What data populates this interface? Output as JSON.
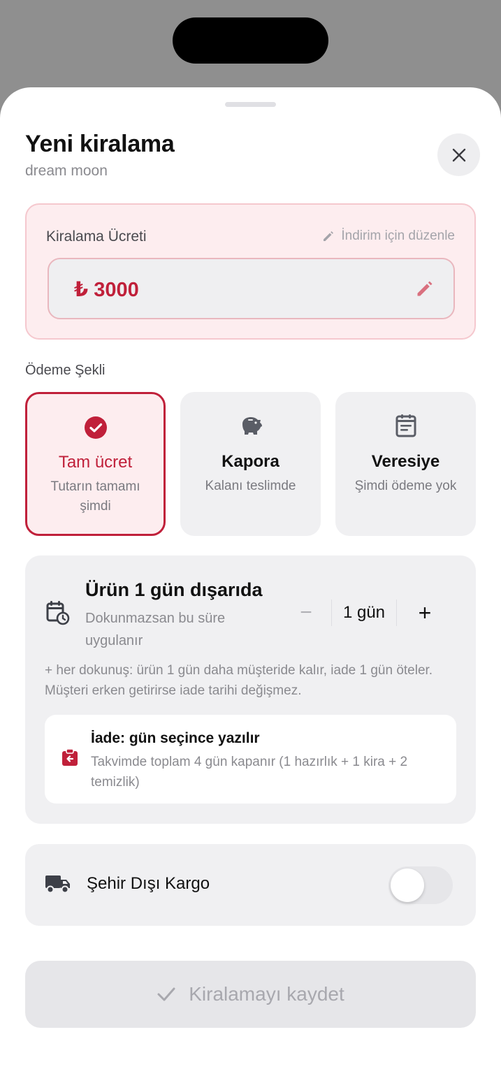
{
  "colors": {
    "accent": "#c0203a",
    "accent_soft": "#fdedef",
    "card_bg": "#f0f0f2",
    "muted_text": "#8a8a8f"
  },
  "header": {
    "title": "Yeni kiralama",
    "subtitle": "dream moon",
    "close_icon": "close-icon"
  },
  "fee": {
    "label": "Kiralama Ücreti",
    "edit_link": "İndirim için düzenle",
    "value": "₺ 3000"
  },
  "payment": {
    "label": "Ödeme Şekli",
    "options": [
      {
        "title": "Tam ücret",
        "desc": "Tutarın tamamı şimdi",
        "icon": "check-circle-icon",
        "selected": true
      },
      {
        "title": "Kapora",
        "desc": "Kalanı teslimde",
        "icon": "piggy-bank-icon",
        "selected": false
      },
      {
        "title": "Veresiye",
        "desc": "Şimdi ödeme yok",
        "icon": "notepad-icon",
        "selected": false
      }
    ]
  },
  "duration": {
    "title": "Ürün 1 gün dışarıda",
    "subtitle": "Dokunmazsan bu süre uygulanır",
    "value": "1 gün",
    "minus": "−",
    "plus": "+",
    "note": "+ her dokunuş: ürün 1 gün daha müşteride kalır, iade 1 gün öteler. Müşteri erken getirirse iade tarihi değişmez.",
    "return_title": "İade: gün seçince yazılır",
    "return_sub": "Takvimde toplam 4 gün kapanır (1 hazırlık + 1 kira + 2 temizlik)"
  },
  "cargo": {
    "label": "Şehir Dışı Kargo",
    "enabled": false
  },
  "save": {
    "label": "Kiralamayı kaydet"
  }
}
